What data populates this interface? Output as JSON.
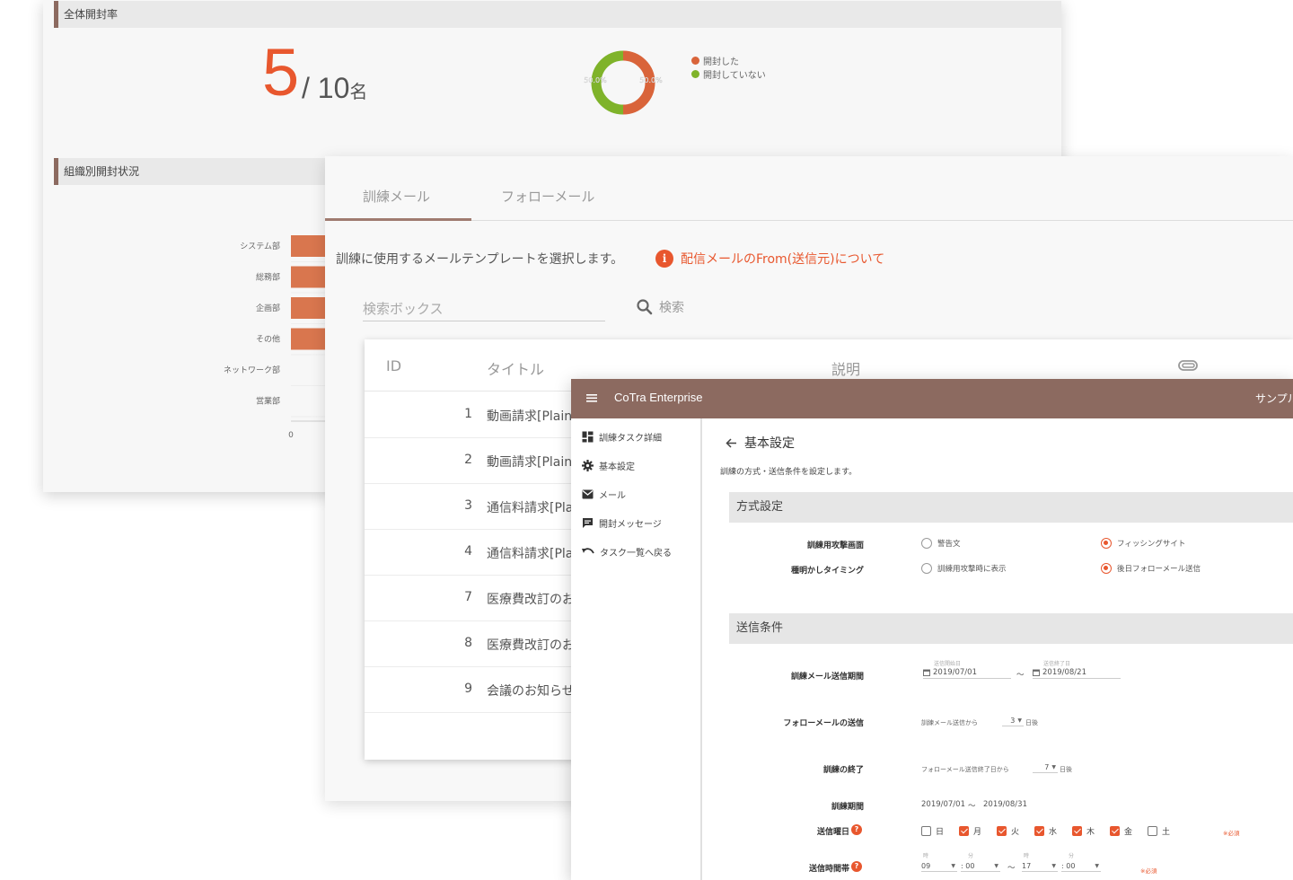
{
  "dashboard": {
    "open_rate_title": "全体開封率",
    "opened_count": "5",
    "total_text": "/ 10",
    "total_unit": "名",
    "org_rate_title": "組織別開封状況",
    "legend": {
      "opened": "開封した",
      "not_opened": "開封していない"
    },
    "colors": {
      "opened": "#d9643a",
      "not_opened": "#7fb32a"
    }
  },
  "chart_data": [
    {
      "type": "pie",
      "categories": [
        "開封した",
        "開封していない"
      ],
      "values": [
        50.0,
        50.0
      ],
      "data_labels": [
        "50.0%",
        "50.0%"
      ]
    },
    {
      "type": "bar",
      "orientation": "horizontal",
      "categories": [
        "システム部",
        "総務部",
        "企画部",
        "その他",
        "ネットワーク部",
        "営業部"
      ],
      "values": [
        1,
        1,
        1,
        1,
        0,
        0
      ],
      "x_ticks": [
        "0"
      ]
    }
  ],
  "templates": {
    "tabs": [
      "訓練メール",
      "フォローメール"
    ],
    "intro": "訓練に使用するメールテンプレートを選択します。",
    "info_link": "配信メールのFrom(送信元)について",
    "search_placeholder": "検索ボックス",
    "search_label": "検索",
    "columns": {
      "id": "ID",
      "title": "タイトル",
      "desc": "説明"
    },
    "rows": [
      {
        "id": "1",
        "title": "動画請求[Plain"
      },
      {
        "id": "2",
        "title": "動画請求[Plain"
      },
      {
        "id": "3",
        "title": "通信料請求[Pla"
      },
      {
        "id": "4",
        "title": "通信料請求[Pla"
      },
      {
        "id": "7",
        "title": "医療費改訂のお"
      },
      {
        "id": "8",
        "title": "医療費改訂のお"
      },
      {
        "id": "9",
        "title": "会議のお知らせ"
      }
    ]
  },
  "cotra": {
    "app_title": "CoTra Enterprise",
    "user": "サンプル",
    "nav": [
      "訓練タスク詳細",
      "基本設定",
      "メール",
      "開封メッセージ",
      "タスク一覧へ戻る"
    ],
    "page_title": "基本設定",
    "page_desc": "訓練の方式・送信条件を設定します。",
    "method_section": "方式設定",
    "attack_screen_label": "訓練用攻撃画面",
    "attack_options": [
      "警告文",
      "フィッシングサイト"
    ],
    "reveal_label": "種明かしタイミング",
    "reveal_options": [
      "訓練用攻撃時に表示",
      "後日フォローメール送信"
    ],
    "send_section": "送信条件",
    "send_period_label": "訓練メール送信期間",
    "send_start_caption": "送信開始日",
    "send_start": "2019/07/01",
    "tilde": "～",
    "send_end_caption": "送信終了日",
    "send_end": "2019/08/21",
    "follow_label": "フォローメールの送信",
    "follow_text": "訓練メール送信から",
    "follow_days": "3",
    "day_unit": "日後",
    "end_label": "訓練の終了",
    "end_text": "フォローメール送信終了日から",
    "end_days": "7",
    "period_label": "訓練期間",
    "period_start": "2019/07/01",
    "period_end": "2019/08/31",
    "weekday_label": "送信曜日",
    "weekdays": [
      {
        "label": "日",
        "checked": false
      },
      {
        "label": "月",
        "checked": true
      },
      {
        "label": "火",
        "checked": true
      },
      {
        "label": "水",
        "checked": true
      },
      {
        "label": "木",
        "checked": true
      },
      {
        "label": "金",
        "checked": true
      },
      {
        "label": "土",
        "checked": false
      }
    ],
    "required": "※必須",
    "time_label": "送信時間帯",
    "hour_caption": "時",
    "minute_caption": "分",
    "start_hour": "09",
    "start_minute": ": 00",
    "end_hour": "17",
    "end_minute": ": 00"
  }
}
